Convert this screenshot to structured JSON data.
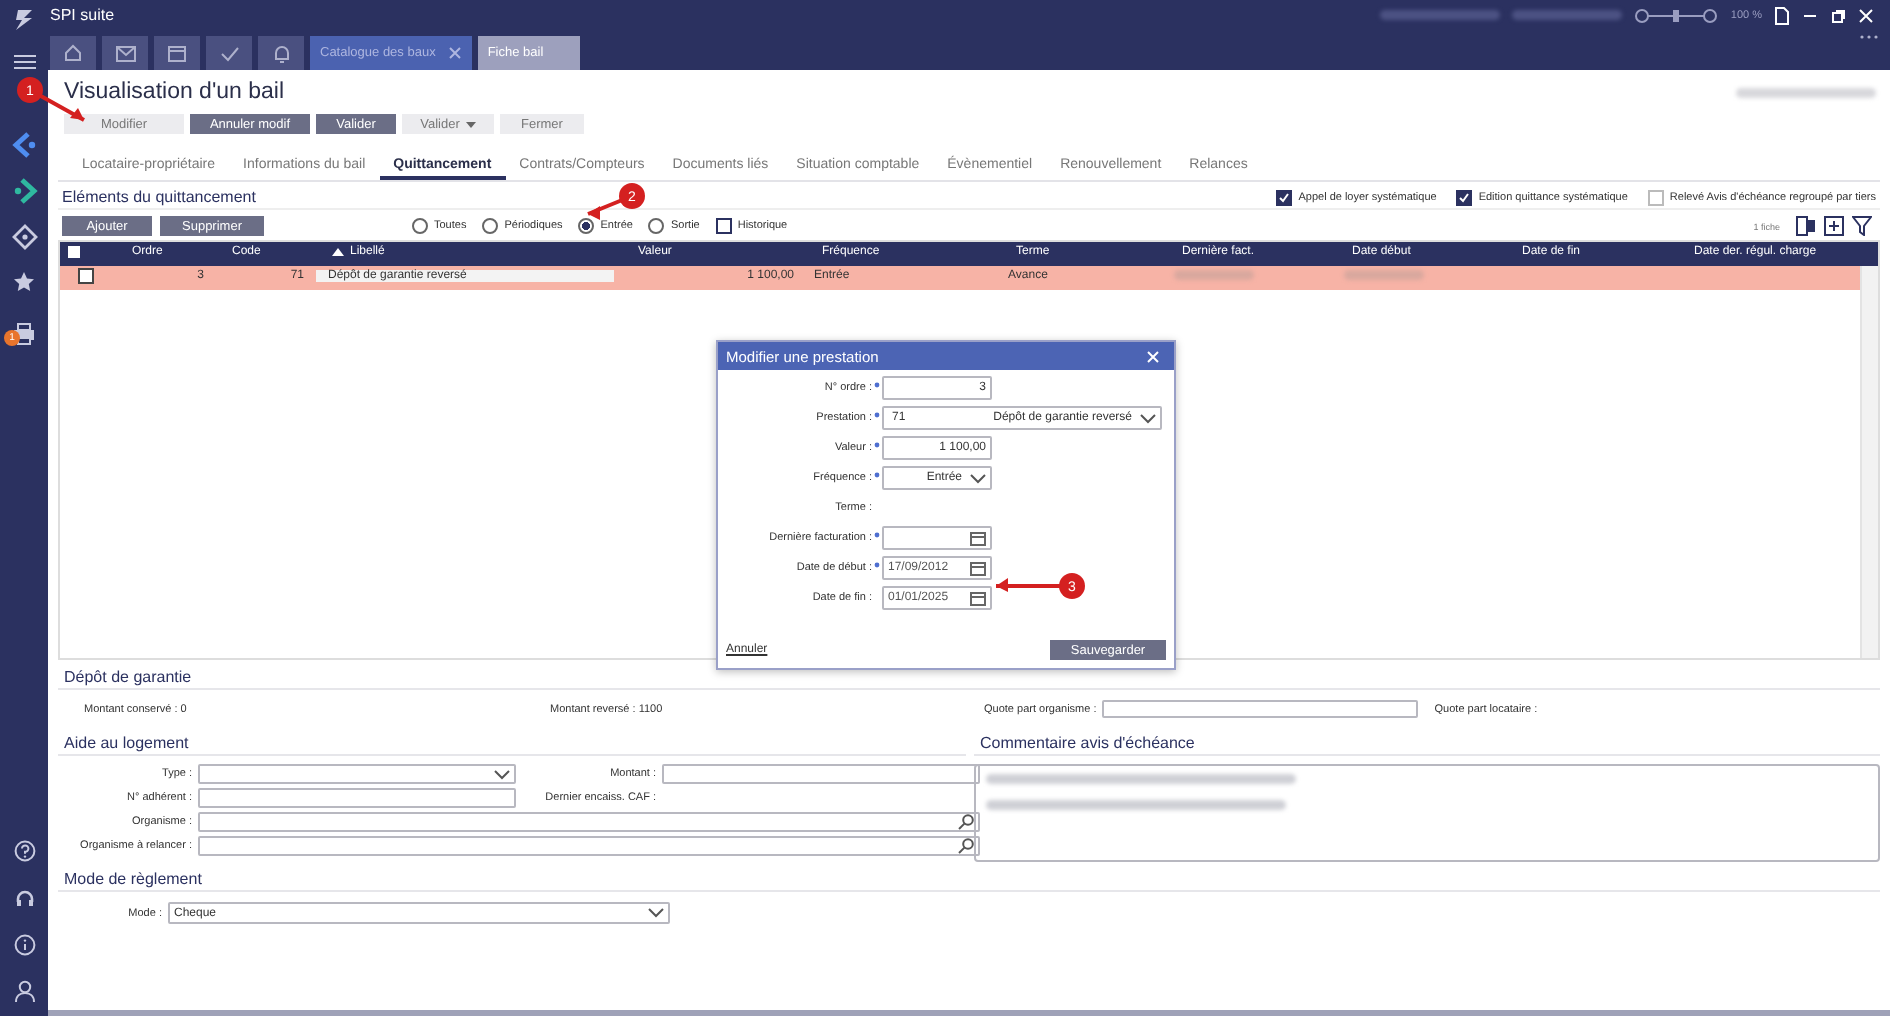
{
  "app": {
    "title": "SPI suite",
    "zoom": "100 %",
    "zoom_slider": {
      "level": 0.5
    }
  },
  "doc_tabs": [
    {
      "label": "Catalogue des baux",
      "selected": false,
      "closable": true
    },
    {
      "label": "Fiche bail",
      "selected": true,
      "closable": false
    }
  ],
  "sidebar": {
    "badge": "1"
  },
  "page": {
    "title": "Visualisation d'un bail"
  },
  "actions": [
    {
      "label": "Modifier",
      "disabled": true,
      "menu": false
    },
    {
      "label": "Annuler modif",
      "disabled": false,
      "menu": false
    },
    {
      "label": "Valider",
      "disabled": false,
      "menu": false
    },
    {
      "label": "Valider",
      "disabled": true,
      "menu": true
    },
    {
      "label": "Fermer",
      "disabled": true,
      "menu": false
    }
  ],
  "tabs": [
    {
      "label": "Locataire-propriétaire",
      "selected": false
    },
    {
      "label": "Informations du bail",
      "selected": false
    },
    {
      "label": "Quittancement",
      "selected": true
    },
    {
      "label": "Contrats/Compteurs",
      "selected": false
    },
    {
      "label": "Documents liés",
      "selected": false
    },
    {
      "label": "Situation comptable",
      "selected": false
    },
    {
      "label": "Évènementiel",
      "selected": false
    },
    {
      "label": "Renouvellement",
      "selected": false
    },
    {
      "label": "Relances",
      "selected": false
    }
  ],
  "billing": {
    "title": "Eléments du quittancement",
    "options": [
      {
        "label": "Appel de loyer systématique",
        "checked": true
      },
      {
        "label": "Edition quittance systématique",
        "checked": true
      },
      {
        "label": "Relevé Avis d'échéance regroupé par tiers",
        "checked": false
      }
    ],
    "buttons": [
      "Ajouter",
      "Supprimer"
    ],
    "filters": [
      {
        "label": "Toutes",
        "selected": false
      },
      {
        "label": "Périodiques",
        "selected": false
      },
      {
        "label": "Entrée",
        "selected": true
      },
      {
        "label": "Sortie",
        "selected": false
      }
    ],
    "history": {
      "label": "Historique",
      "checked": false
    },
    "record_count": "1 fiche"
  },
  "table": {
    "all_checked": false,
    "columns": [
      {
        "label": "Ordre",
        "sorted": false
      },
      {
        "label": "Code",
        "sorted": false
      },
      {
        "label": "Libellé",
        "sorted": true
      },
      {
        "label": "Valeur",
        "sorted": false
      },
      {
        "label": "Fréquence",
        "sorted": false
      },
      {
        "label": "Terme",
        "sorted": false
      },
      {
        "label": "Dernière fact.",
        "sorted": false
      },
      {
        "label": "Date début",
        "sorted": false
      },
      {
        "label": "Date de fin",
        "sorted": false
      },
      {
        "label": "Date der. régul. charge",
        "sorted": false
      }
    ],
    "rows": [
      {
        "selected": true,
        "checked": false,
        "cells": [
          "3",
          "71",
          "Dépôt de garantie reversé",
          "1 100,00",
          "Entrée",
          "Avance",
          {
            "redacted": true
          },
          {
            "redacted": true
          },
          null,
          null
        ]
      }
    ]
  },
  "dialog": {
    "title": "Modifier une prestation",
    "fields": [
      {
        "kind": "number",
        "label": "N° ordre :",
        "required": true,
        "value": "3"
      },
      {
        "kind": "select",
        "label": "Prestation :",
        "required": true,
        "code": "71",
        "value": "Dépôt de garantie reversé"
      },
      {
        "kind": "number",
        "label": "Valeur :",
        "required": true,
        "value": "1 100,00"
      },
      {
        "kind": "select",
        "label": "Fréquence :",
        "required": true,
        "value": "Entrée"
      },
      {
        "kind": "static",
        "label": "Terme :",
        "required": false
      },
      {
        "kind": "date",
        "label": "Dernière facturation :",
        "required": true
      },
      {
        "kind": "date",
        "label": "Date de début :",
        "required": true,
        "value": "17/09/2012"
      },
      {
        "kind": "date",
        "label": "Date de fin :",
        "required": false,
        "value": "01/01/2025"
      }
    ],
    "cancel": "Annuler",
    "save": "Sauvegarder"
  },
  "callouts": [
    "1",
    "2",
    "3"
  ],
  "deposit": {
    "title": "Dépôt de garantie",
    "kept_label": "Montant conservé :",
    "kept_value": "0",
    "returned_label": "Montant reversé :",
    "returned_value": "1100",
    "org_share_label": "Quote part organisme :",
    "tenant_share_label": "Quote part locataire :"
  },
  "housing_aid": {
    "title": "Aide au logement",
    "type_label": "Type :",
    "amount_label": "Montant :",
    "member_label": "N° adhérent :",
    "last_caf_label": "Dernier encaiss. CAF :",
    "org_label": "Organisme :",
    "org_remind_label": "Organisme à relancer :"
  },
  "notice_comment": {
    "title": "Commentaire avis d'échéance"
  },
  "payment": {
    "title": "Mode de règlement",
    "mode_label": "Mode :",
    "mode_value": "Cheque"
  }
}
